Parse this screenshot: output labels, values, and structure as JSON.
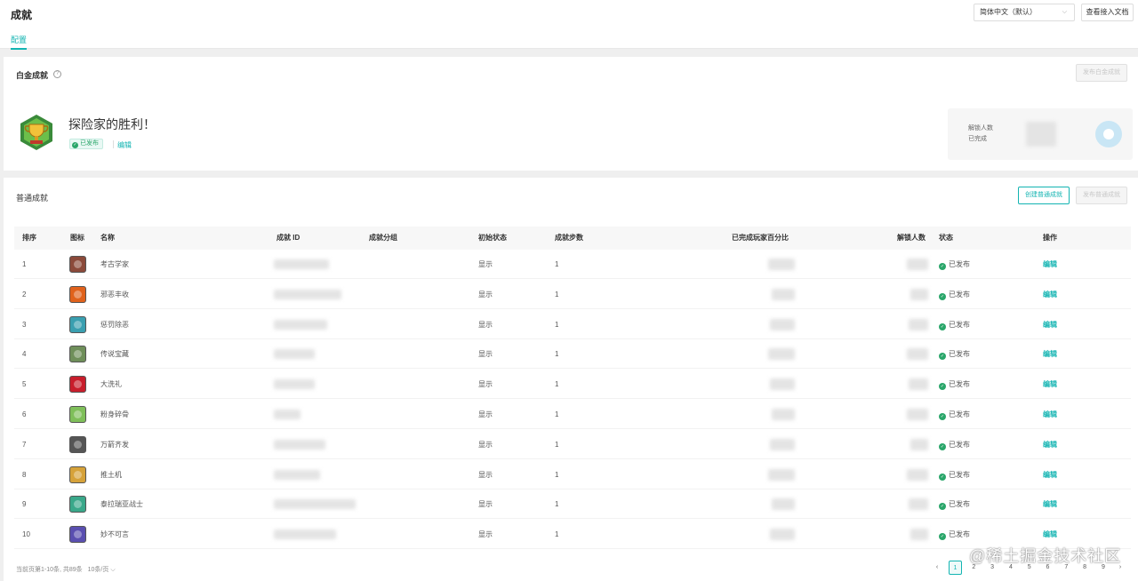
{
  "header": {
    "title": "成就",
    "tab": "配置",
    "language": "简体中文（默认）",
    "doc_button": "查看接入文档"
  },
  "platinum": {
    "section_title": "白金成就",
    "publish_button": "发布白金成就",
    "name": "探险家的胜利！",
    "status": "已发布",
    "edit": "编辑",
    "unlock_label": "解锁人数",
    "completed_label": "已完成"
  },
  "normal": {
    "section_title": "普通成就",
    "create_button": "创建普通成就",
    "publish_button": "发布普通成就",
    "columns": [
      "排序",
      "图标",
      "名称",
      "成就 ID",
      "成就分组",
      "初始状态",
      "成就步数",
      "已完成玩家百分比",
      "解锁人数",
      "状态",
      "操作"
    ],
    "rows": [
      {
        "order": "1",
        "name": "考古学家",
        "init": "显示",
        "steps": "1",
        "status": "已发布",
        "action": "编辑",
        "icon_color": "#8b4a3a"
      },
      {
        "order": "2",
        "name": "邪恶丰收",
        "init": "显示",
        "steps": "1",
        "status": "已发布",
        "action": "编辑",
        "icon_color": "#e0621c"
      },
      {
        "order": "3",
        "name": "惩罚除恶",
        "init": "显示",
        "steps": "1",
        "status": "已发布",
        "action": "编辑",
        "icon_color": "#3a9fb0"
      },
      {
        "order": "4",
        "name": "传说宝藏",
        "init": "显示",
        "steps": "1",
        "status": "已发布",
        "action": "编辑",
        "icon_color": "#6f8f5a"
      },
      {
        "order": "5",
        "name": "大洗礼",
        "init": "显示",
        "steps": "1",
        "status": "已发布",
        "action": "编辑",
        "icon_color": "#c81e2c"
      },
      {
        "order": "6",
        "name": "粉身碎骨",
        "init": "显示",
        "steps": "1",
        "status": "已发布",
        "action": "编辑",
        "icon_color": "#7fbf5a"
      },
      {
        "order": "7",
        "name": "万箭齐发",
        "init": "显示",
        "steps": "1",
        "status": "已发布",
        "action": "编辑",
        "icon_color": "#555555"
      },
      {
        "order": "8",
        "name": "推土机",
        "init": "显示",
        "steps": "1",
        "status": "已发布",
        "action": "编辑",
        "icon_color": "#d6a23a"
      },
      {
        "order": "9",
        "name": "泰拉瑞亚战士",
        "init": "显示",
        "steps": "1",
        "status": "已发布",
        "action": "编辑",
        "icon_color": "#3aa88a"
      },
      {
        "order": "10",
        "name": "妙不可言",
        "init": "显示",
        "steps": "1",
        "status": "已发布",
        "action": "编辑",
        "icon_color": "#5a4fb0"
      }
    ],
    "footer": {
      "info": "当前页第1-10条, 共89条",
      "page_size": "10条/页",
      "pages": [
        "1",
        "2",
        "3",
        "4",
        "5",
        "6",
        "7",
        "8",
        "9"
      ],
      "current_page": "1",
      "prev": "‹",
      "next": "›"
    }
  },
  "watermark": "@稀土掘金技术社区"
}
